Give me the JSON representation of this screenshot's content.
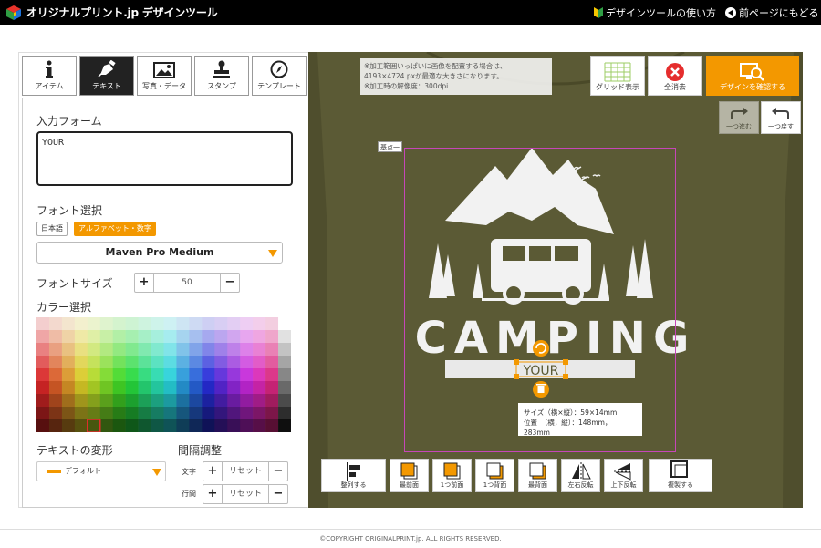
{
  "header": {
    "logo_text": "オリジナルプリント.jp デザインツール",
    "help_link": "デザインツールの使い方",
    "back_link": "前ページにもどる"
  },
  "tabs": [
    {
      "label": "アイテム",
      "icon": "info-icon",
      "active": false
    },
    {
      "label": "テキスト",
      "icon": "pen-icon",
      "active": true
    },
    {
      "label": "写真・データ",
      "icon": "image-icon",
      "active": false
    },
    {
      "label": "スタンプ",
      "icon": "stamp-icon",
      "active": false
    },
    {
      "label": "テンプレート",
      "icon": "compass-icon",
      "active": false
    }
  ],
  "text_panel": {
    "input_label": "入力フォーム",
    "input_value": "YOUR",
    "font_label": "フォント選択",
    "font_cat_jp": "日本語",
    "font_cat_en": "アルファベット・数字",
    "font_name": "Maven Pro Medium",
    "size_label": "フォントサイズ",
    "size_value": "50",
    "color_label": "カラー選択",
    "warp_label": "テキストの変形",
    "warp_value": "デフォルト",
    "spacing_label": "間隔調整",
    "char_label": "文字",
    "line_label": "行間",
    "reset_label": "リセット"
  },
  "canvas": {
    "notice_lines": [
      "※加工範囲いっぱいに画像を配置する場合は、",
      "4193×4724 pxが最適な大きさになります。",
      "※加工時の解像度：300dpi"
    ],
    "grid_label": "グリッド表示",
    "clear_label": "全消去",
    "confirm_label": "デザインを確認する",
    "redo_label": "一つ進む",
    "undo_label": "一つ戻す",
    "base_point_label": "基点一",
    "design_title": "CAMPING",
    "design_sub": "YOUR",
    "size_info": "サイズ（横×縦）：59×14mm",
    "position_info": "位置　（横，縦）：148mm，283mm",
    "shirt_color": "#5b5a35"
  },
  "bottom_toolbar": [
    {
      "label": "整列する",
      "icon": "align-icon"
    },
    {
      "label": "最前面",
      "icon": "bring-front-icon"
    },
    {
      "label": "1つ前面",
      "icon": "bring-forward-icon"
    },
    {
      "label": "1つ背面",
      "icon": "send-backward-icon"
    },
    {
      "label": "最背面",
      "icon": "send-back-icon"
    },
    {
      "label": "左右反転",
      "icon": "flip-horizontal-icon"
    },
    {
      "label": "上下反転",
      "icon": "flip-vertical-icon"
    },
    {
      "label": "複製する",
      "icon": "duplicate-icon"
    }
  ],
  "footer": {
    "copyright": "©COPYRIGHT ORIGINALPRINT.jp. ALL RIGHTS RESERVED."
  },
  "colors": {
    "accent": "#f39800",
    "header_bg": "#000000",
    "print_area": "#c646b8"
  }
}
